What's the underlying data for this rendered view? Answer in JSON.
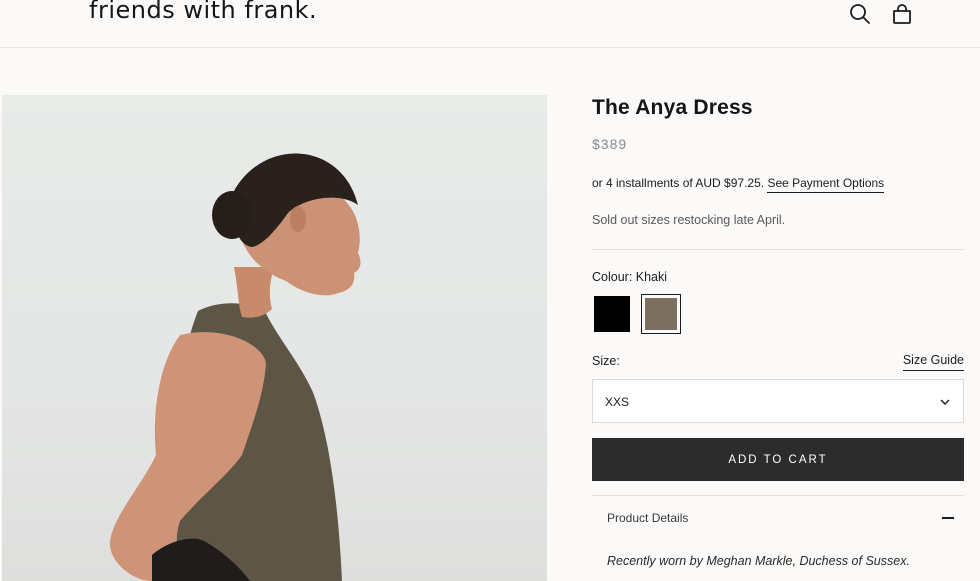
{
  "header": {
    "logo": "friends with frank.",
    "icons": [
      "search-icon",
      "shopping-bag-icon"
    ]
  },
  "product": {
    "title": "The Anya Dress",
    "price": "$389",
    "installments_text": "or 4 installments of AUD $97.25.",
    "installments_link": "See Payment Options",
    "restock_note": "Sold out sizes restocking late April.",
    "colour_label": "Colour: Khaki",
    "colours": [
      {
        "name": "Black",
        "hex": "#000000",
        "selected": false
      },
      {
        "name": "Khaki",
        "hex": "#7b6f61",
        "selected": true
      }
    ],
    "size_label": "Size:",
    "size_guide": "Size Guide",
    "selected_size": "XXS",
    "add_to_cart": "ADD TO CART",
    "details_title": "Product Details",
    "details_text": "Recently worn by Meghan Markle, Duchess of Sussex."
  },
  "colors": {
    "background": "#fbfaf8",
    "button": "#2c2c2c",
    "price": "#8a8a8a"
  }
}
